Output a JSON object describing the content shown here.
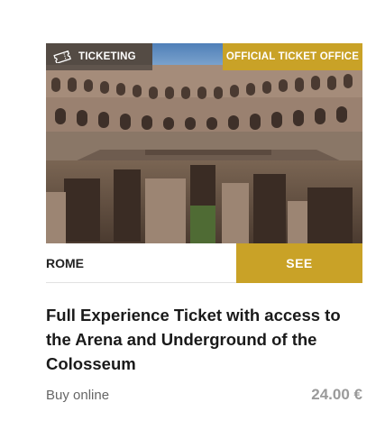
{
  "badges": {
    "category": "TICKETING",
    "category_icon": "ticket-icon",
    "official": "OFFICIAL TICKET OFFICE"
  },
  "image": {
    "subject": "colosseum-arena-photo"
  },
  "card": {
    "city": "ROME",
    "cta": "SEE",
    "title": "Full Experience Ticket with access to the Arena and Underground of the Colosseum",
    "buy_label": "Buy online",
    "price": "24.00 €"
  },
  "colors": {
    "accent": "#c9a227",
    "badge_overlay": "#282828",
    "text": "#1a1a1a",
    "muted": "#9a9a9a"
  }
}
